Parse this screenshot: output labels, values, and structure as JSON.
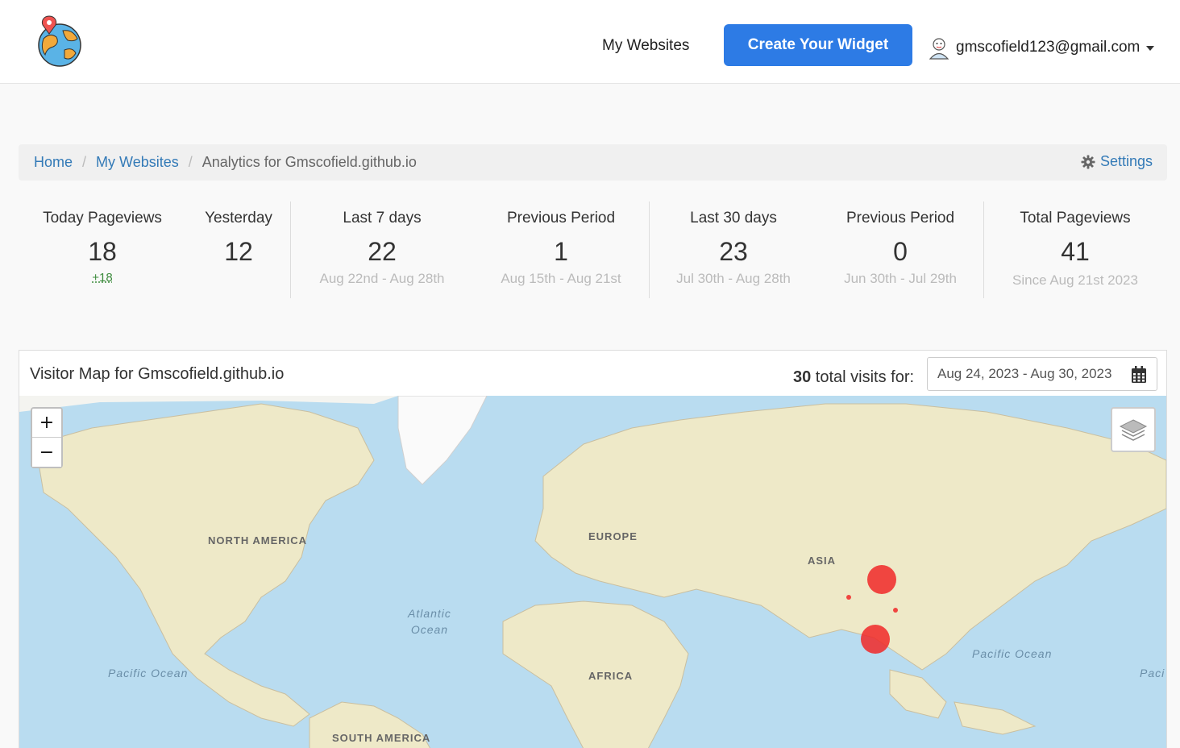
{
  "header": {
    "nav_link": "My Websites",
    "cta_label": "Create Your Widget",
    "user_email": "gmscofield123@gmail.com"
  },
  "breadcrumb": {
    "home": "Home",
    "my_websites": "My Websites",
    "current": "Analytics for Gmscofield.github.io",
    "settings": "Settings"
  },
  "stats": {
    "today": {
      "label": "Today Pageviews",
      "value": "18",
      "delta": "+18"
    },
    "yesterday": {
      "label": "Yesterday",
      "value": "12"
    },
    "last7": {
      "label": "Last 7 days",
      "value": "22",
      "range": "Aug 22nd - Aug 28th"
    },
    "prev7": {
      "label": "Previous Period",
      "value": "1",
      "range": "Aug 15th - Aug 21st"
    },
    "last30": {
      "label": "Last 30 days",
      "value": "23",
      "range": "Jul 30th - Aug 28th"
    },
    "prev30": {
      "label": "Previous Period",
      "value": "0",
      "range": "Jun 30th - Jul 29th"
    },
    "total": {
      "label": "Total Pageviews",
      "value": "41",
      "since": "Since Aug 21st 2023"
    }
  },
  "map_panel": {
    "title": "Visitor Map for Gmscofield.github.io",
    "visits_count": "30",
    "visits_suffix": " total visits for:",
    "date_range": "Aug 24, 2023 - Aug 30, 2023",
    "zoom_in": "+",
    "zoom_out": "−",
    "labels": {
      "north_america": "NORTH AMERICA",
      "europe": "EUROPE",
      "asia": "ASIA",
      "africa": "AFRICA",
      "south_america": "SOUTH AMERICA",
      "atlantic_1": "Atlantic",
      "atlantic_2": "Ocean",
      "pacific_left": "Pacific Ocean",
      "pacific_right": "Pacific Ocean",
      "pacific_edge": "Paci"
    }
  },
  "colors": {
    "accent": "#2d7be5",
    "link": "#337ab7",
    "marker": "#f02828",
    "ocean": "#b9dcf0",
    "land": "#eee9c8"
  }
}
